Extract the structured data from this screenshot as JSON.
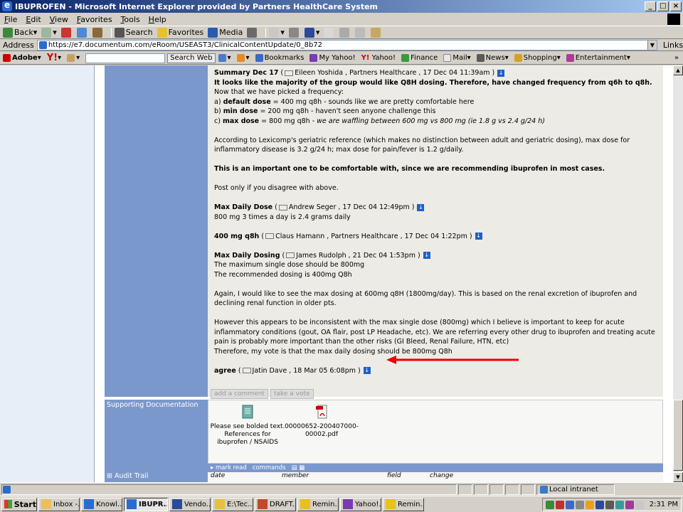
{
  "window": {
    "title": "IBUPROFEN - Microsoft Internet Explorer provided by Partners HealthCare System"
  },
  "menu": [
    "File",
    "Edit",
    "View",
    "Favorites",
    "Tools",
    "Help"
  ],
  "toolbar": {
    "back": "Back",
    "search": "Search",
    "favorites": "Favorites",
    "media": "Media"
  },
  "address": {
    "label": "Address",
    "url": "https://e7.documentum.com/eRoom/USEAST3/ClinicalContentUpdate/0_8b72",
    "links": "Links"
  },
  "yahoo": {
    "adobe": "Adobe",
    "search_web": "Search Web",
    "bookmarks": "Bookmarks",
    "my_yahoo": "My Yahoo!",
    "yahoo": "Yahoo!",
    "finance": "Finance",
    "mail": "Mail",
    "news": "News",
    "shopping": "Shopping",
    "entertainment": "Entertainment"
  },
  "discussion": {
    "summary_title": "Summary Dec 17",
    "summary_meta": "Eileen Yoshida , Partners Healthcare , 17 Dec 04  11:39am )",
    "summary_bold": "It looks like the majority of the group would like Q8H dosing.  Therefore, have changed frequency from q6h to q8h.",
    "summary_rest": "  Now that we have picked a frequency:",
    "a_label": "default dose",
    "a_text": " = 400 mg q8h - sounds like we are pretty comfortable here",
    "b_label": "min dose",
    "b_text": " = 200 mg q8h - haven't seen anyone challenge this",
    "c_label": "max dose",
    "c_text": " = 800 mg q8h - ",
    "c_italic": "we are waffling between 600 mg vs 800 mg (ie 1.8 g vs 2.4 g/24 h)",
    "lexicomp": "According to Lexicomp's geriatric reference (which makes no distinction between adult and geriatric dosing), max dose for inflammatory disease is 3.2 g/24 h; max dose for pain/fever is 1.2 g/daily.",
    "important": "This is an important one to be comfortable with, since we are recommending ibuprofen in most cases.",
    "post_only": "Post only if you disagree with above.",
    "c1_title": "Max Daily Dose",
    "c1_meta": "Andrew Seger , 17 Dec 04  12:49pm )",
    "c1_text": "800 mg 3 times a day is 2.4 grams daily",
    "c2_title": "400 mg q8h",
    "c2_meta": "Claus Hamann , Partners Healthcare , 17 Dec 04  1:22pm )",
    "c3_title": "Max Daily Dosing",
    "c3_meta": "James Rudolph , 21 Dec 04  1:53pm )",
    "c3_l1": "The maximum single dose should be 800mg",
    "c3_l2": "The recommended dosing is 400mg Q8h",
    "c3_p2": "Again, I would like to see the max dosing at 600mg q8H (1800mg/day).  This is based on the renal excretion of ibuprofen and declining renal function in older pts.",
    "c3_p3": "However this appears to be inconsistent with the max single dose (800mg) which I believe is important to keep for acute inflammatory conditions (gout, OA flair, post LP Headache, etc).  We are referring every other drug to ibuprofen and treating acute pain is probably more important than the other risks (GI Bleed, Renal Failure, HTN, etc)",
    "c3_p4": "Therefore, my vote is that the max daily dosing should be 800mg Q8h",
    "c4_title": "agree",
    "c4_meta": "Jatin Dave , 18 Mar 05  6:08pm )",
    "add_comment": "add a comment",
    "take_vote": "take a vote"
  },
  "supporting": {
    "label": "Supporting Documentation",
    "doc1": "Please see bolded text. References for ibuprofen / NSAIDS",
    "doc2": "00000652-200407000-00002.pdf",
    "mark_read": "mark read",
    "commands": "commands"
  },
  "audit": {
    "label": "Audit Trail",
    "cols": [
      "date",
      "member",
      "field",
      "change"
    ]
  },
  "status": {
    "zone": "Local intranet"
  },
  "taskbar": {
    "start": "Start",
    "tasks": [
      "Inbox -...",
      "Knowl...",
      "IBUPR...",
      "Vendo...",
      "E:\\Tec...",
      "DRAFT...",
      "Remin...",
      "Yahoo!...",
      "Remin..."
    ],
    "clock": "2:31 PM"
  }
}
